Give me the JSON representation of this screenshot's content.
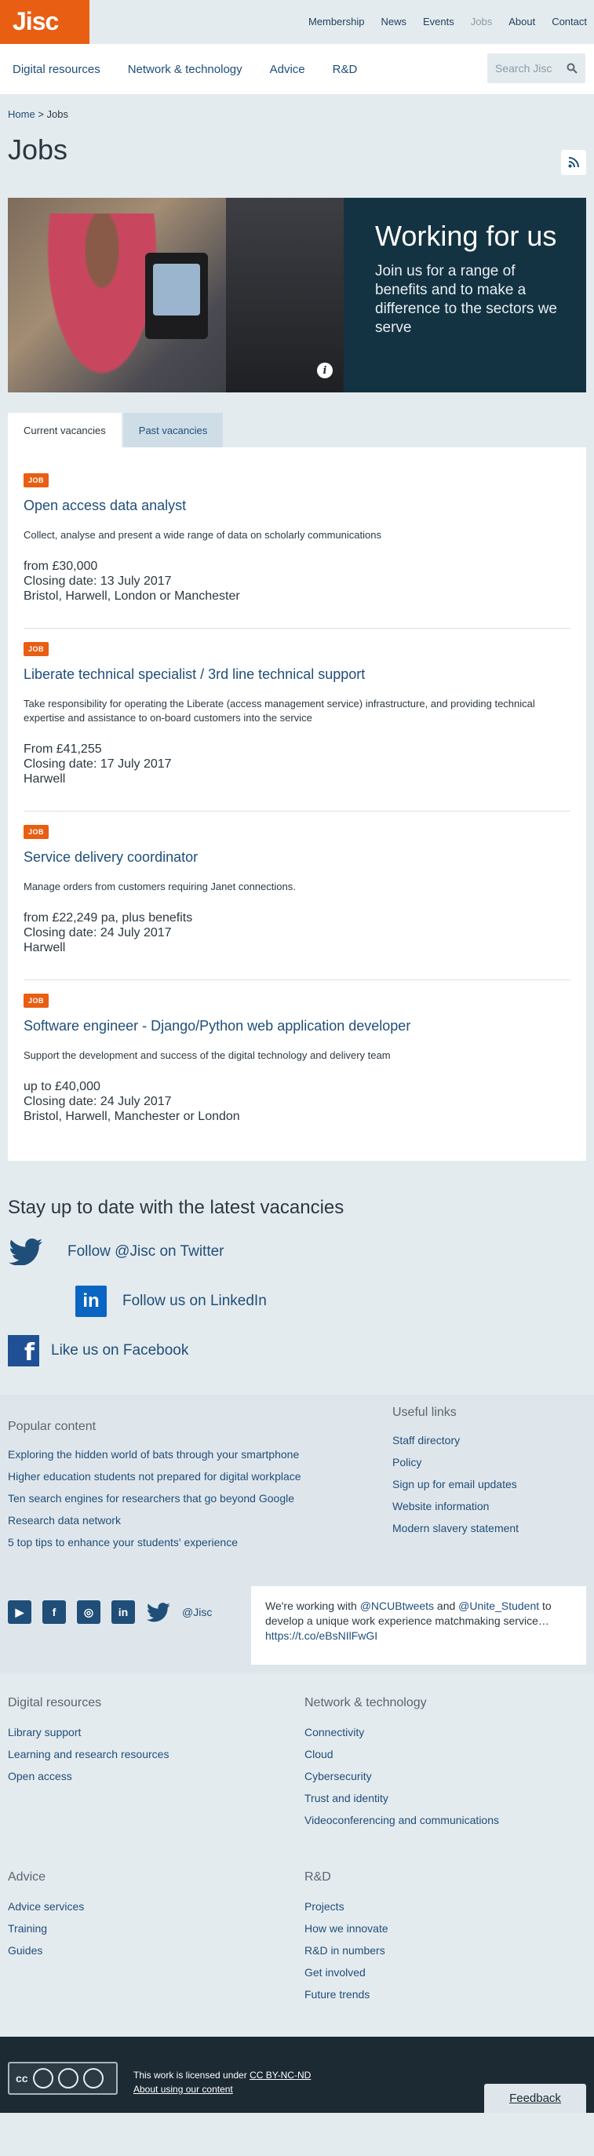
{
  "header": {
    "logo": "Jisc",
    "top_nav": [
      "Membership",
      "News",
      "Events",
      "Jobs",
      "About",
      "Contact"
    ],
    "main_nav": [
      "Digital resources",
      "Network & technology",
      "Advice",
      "R&D"
    ],
    "search_placeholder": "Search Jisc"
  },
  "breadcrumb": {
    "home": "Home",
    "sep": ">",
    "current": "Jobs"
  },
  "page": {
    "title": "Jobs"
  },
  "hero": {
    "title": "Working for us",
    "text": "Join us for a range of benefits and to make a difference to the sectors we serve",
    "info": "i"
  },
  "tabs": [
    "Current vacancies",
    "Past vacancies"
  ],
  "jobs": [
    {
      "badge": "JOB",
      "title": "Open access data analyst",
      "desc": "Collect, analyse and present a wide range of data on scholarly communications",
      "salary": "from £30,000",
      "closing": "Closing date: 13 July 2017",
      "location": "Bristol, Harwell, London or Manchester"
    },
    {
      "badge": "JOB",
      "title": "Liberate technical specialist / 3rd line technical support",
      "desc": "Take responsibility for operating the Liberate (access management service) infrastructure, and providing technical expertise and assistance to on-board customers into the service",
      "salary": "From £41,255",
      "closing": "Closing date: 17 July 2017",
      "location": "Harwell"
    },
    {
      "badge": "JOB",
      "title": "Service delivery coordinator",
      "desc": "Manage orders from customers requiring Janet connections.",
      "salary": "from £22,249 pa, plus benefits",
      "closing": "Closing date: 24 July 2017",
      "location": "Harwell"
    },
    {
      "badge": "JOB",
      "title": "Software engineer - Django/Python web application developer",
      "desc": "Support the development and success of the digital technology and delivery team",
      "salary": "up to £40,000",
      "closing": "Closing date: 24 July 2017",
      "location": "Bristol, Harwell, Manchester or London"
    }
  ],
  "follow": {
    "title": "Stay up to date with the latest vacancies",
    "twitter": "Follow @Jisc on Twitter",
    "linkedin": "Follow us on LinkedIn",
    "facebook": "Like us on Facebook"
  },
  "popular": {
    "title": "Popular content",
    "items": [
      "Exploring the hidden world of bats through your smartphone",
      "Higher education students not prepared for digital workplace",
      "Ten search engines for researchers that go beyond Google",
      "Research data network",
      "5 top tips to enhance your students' experience"
    ]
  },
  "useful": {
    "title": "Useful links",
    "items": [
      "Staff directory",
      "Policy",
      "Sign up for email updates",
      "Website information",
      "Modern slavery statement"
    ]
  },
  "social": {
    "handle": "@Jisc",
    "tweet_pre": "We're working with ",
    "tweet_h1": "@NCUBtweets",
    "tweet_and": " and ",
    "tweet_h2": "@Unite_Student",
    "tweet_post": " to develop a unique work experience matchmaking service… ",
    "tweet_link": "https://t.co/eBsNIlFwGI"
  },
  "footer": {
    "digital": {
      "title": "Digital resources",
      "items": [
        "Library support",
        "Learning and research resources",
        "Open access"
      ]
    },
    "network": {
      "title": "Network & technology",
      "items": [
        "Connectivity",
        "Cloud",
        "Cybersecurity",
        "Trust and identity",
        "Videoconferencing and communications"
      ]
    },
    "advice": {
      "title": "Advice",
      "items": [
        "Advice services",
        "Training",
        "Guides"
      ]
    },
    "rd": {
      "title": "R&D",
      "items": [
        "Projects",
        "How we innovate",
        "R&D in numbers",
        "Get involved",
        "Future trends"
      ]
    }
  },
  "bottom": {
    "cc_label": "cc",
    "license_pre": "This work is licensed under ",
    "license_link": "CC BY-NC-ND",
    "about": "About using our content",
    "feedback": "Feedback"
  }
}
